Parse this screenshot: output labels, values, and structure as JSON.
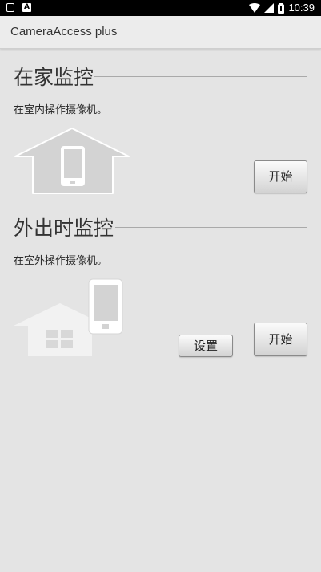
{
  "status_bar": {
    "time": "10:39",
    "icons": [
      "square-notification-icon",
      "a-notification-icon",
      "wifi-icon",
      "signal-icon",
      "battery-icon"
    ]
  },
  "app": {
    "title": "CameraAccess plus"
  },
  "home_section": {
    "title": "在家监控",
    "description": "在室内操作摄像机。",
    "start_label": "开始"
  },
  "away_section": {
    "title": "外出时监控",
    "description": "在室外操作摄像机。",
    "settings_label": "设置",
    "start_label": "开始"
  }
}
